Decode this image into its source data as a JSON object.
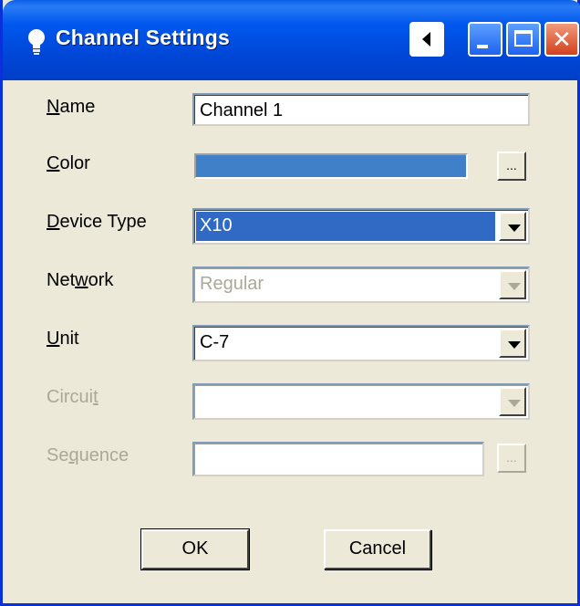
{
  "window": {
    "title": "Channel Settings",
    "icon": "lightbulb-icon",
    "controls": {
      "back": "back-arrow-icon",
      "minimize": "minimize-icon",
      "maximize": "maximize-icon",
      "close": "close-icon",
      "close_glyph": "✕"
    }
  },
  "form": {
    "name": {
      "label_prefix": "",
      "label_mnemonic": "N",
      "label_rest": "ame",
      "value": "Channel 1"
    },
    "color": {
      "label_prefix": "",
      "label_mnemonic": "C",
      "label_rest": "olor",
      "swatch": "#4080c8",
      "button": "..."
    },
    "device_type": {
      "label_prefix": "",
      "label_mnemonic": "D",
      "label_rest": "evice Type",
      "value": "X10"
    },
    "network": {
      "label_prefix": "Net",
      "label_mnemonic": "w",
      "label_rest": "ork",
      "value": "Regular",
      "disabled": true
    },
    "unit": {
      "label_prefix": "",
      "label_mnemonic": "U",
      "label_rest": "nit",
      "value": "C-7"
    },
    "circuit": {
      "label_prefix": "Circui",
      "label_mnemonic": "t",
      "label_rest": "",
      "value": "",
      "disabled": true
    },
    "sequence": {
      "label_prefix": "Se",
      "label_mnemonic": "q",
      "label_rest": "uence",
      "value": "",
      "button": "...",
      "disabled": true
    }
  },
  "buttons": {
    "ok": "OK",
    "cancel": "Cancel"
  },
  "colors": {
    "selection": "#316ac5",
    "face": "#ece9d8",
    "titlebar": "#0058ee",
    "disabled_text": "#aca899"
  }
}
